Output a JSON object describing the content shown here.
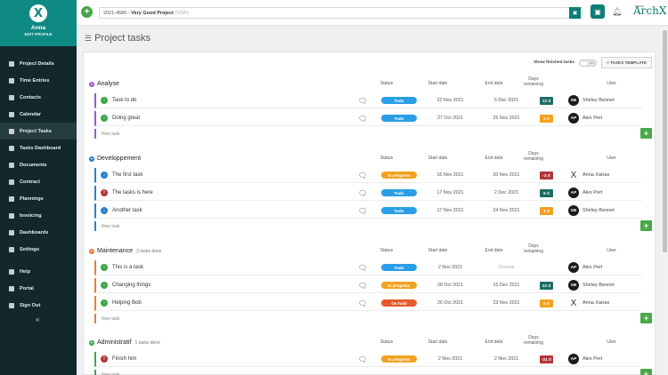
{
  "sidebar": {
    "user_name": "Anna",
    "edit_profile": "EDIT PROFILE",
    "items": [
      {
        "label": "Project Details",
        "icon": "page-icon"
      },
      {
        "label": "Time Entries",
        "icon": "clock-icon"
      },
      {
        "label": "Contacts",
        "icon": "contacts-icon"
      },
      {
        "label": "Calendar",
        "icon": "calendar-icon"
      },
      {
        "label": "Project Tasks",
        "icon": "tasks-icon",
        "active": true
      },
      {
        "label": "Tasks Dashboard",
        "icon": "dashboard-icon"
      },
      {
        "label": "Documents",
        "icon": "folder-icon"
      },
      {
        "label": "Contract",
        "icon": "contract-icon"
      },
      {
        "label": "Plannings",
        "icon": "planning-icon"
      },
      {
        "label": "Invoicing",
        "icon": "invoice-icon"
      },
      {
        "label": "Dashboards",
        "icon": "chart-icon"
      },
      {
        "label": "Settings",
        "icon": "gear-icon"
      }
    ],
    "footer": [
      {
        "label": "Help",
        "icon": "help-icon"
      },
      {
        "label": "Portal",
        "icon": "portal-icon"
      },
      {
        "label": "Sign Out",
        "icon": "signout-icon"
      }
    ],
    "collapse": "«"
  },
  "topbar": {
    "project_code": "2021-4586 - ",
    "project_name": "Very Good Project",
    "project_suffix": " (VGP)",
    "brand_small": "cloud",
    "brand": "ArchX"
  },
  "page": {
    "title": "Project tasks",
    "show_finished_label": "Show finished tasks",
    "toggle_label": "NO",
    "template_button": "+ TASKS TEMPLATE"
  },
  "columns": {
    "status": "Status",
    "start": "Start date",
    "end": "End date",
    "days": "Days remaining",
    "user": "User"
  },
  "new_task_placeholder": "New task",
  "colors": {
    "brand": "#0f8a82",
    "todo": "#2a9ee6",
    "in_progress": "#f0a220",
    "on_hold": "#e55a2a",
    "done_green": "#4aa84a"
  },
  "sections": [
    {
      "title": "Analyse",
      "done": "",
      "color": "#9b59d0",
      "tasks": [
        {
          "name": "Task to do",
          "icon": "up",
          "status": "Todo",
          "status_color": "#2a9ee6",
          "start": "22 Nov 2021",
          "end": "5 Dec 2021",
          "days": "12 d",
          "days_color": "#1e6b63",
          "initials": "SB",
          "user": "Shirley Bennet"
        },
        {
          "name": "Doing great",
          "icon": "up",
          "status": "Todo",
          "status_color": "#2a9ee6",
          "start": "27 Oct 2021",
          "end": "25 Nov 2021",
          "days": "2 d",
          "days_color": "#f0a220",
          "initials": "AP",
          "user": "Alex Pert"
        }
      ]
    },
    {
      "title": "Developpement",
      "done": "",
      "color": "#2a80d0",
      "tasks": [
        {
          "name": "The first task",
          "icon": "down",
          "status": "In progress",
          "status_color": "#f0a220",
          "start": "16 Nov 2021",
          "end": "20 Nov 2021",
          "days": "-3 d",
          "days_color": "#b0353a",
          "initials": "X",
          "user": "Anna Xatrax"
        },
        {
          "name": "The tasks is here",
          "icon": "urgent",
          "status": "Todo",
          "status_color": "#2a9ee6",
          "start": "17 Nov 2021",
          "end": "2 Dec 2021",
          "days": "9 d",
          "days_color": "#1e6b63",
          "initials": "AP",
          "user": "Alex Pert"
        },
        {
          "name": "Another task",
          "icon": "down",
          "status": "Todo",
          "status_color": "#2a9ee6",
          "start": "17 Nov 2021",
          "end": "24 Nov 2021",
          "days": "1 d",
          "days_color": "#f0a220",
          "initials": "SB",
          "user": "Shirley Bennet"
        }
      ]
    },
    {
      "title": "Maintenance",
      "done": "2 tasks done",
      "color": "#ee7b3a",
      "tasks": [
        {
          "name": "This is a task",
          "icon": "up",
          "status": "Todo",
          "status_color": "#2a9ee6",
          "start": "2 Nov 2021",
          "end": "Choose",
          "days": "",
          "days_color": "",
          "initials": "AP",
          "user": "Alex Pert"
        },
        {
          "name": "Changing things",
          "icon": "up",
          "status": "In progress",
          "status_color": "#f0a220",
          "start": "28 Oct 2021",
          "end": "15 Dec 2021",
          "days": "22 d",
          "days_color": "#1e6b63",
          "initials": "SB",
          "user": "Shirley Bennet"
        },
        {
          "name": "Helping Bob",
          "icon": "up",
          "status": "On hold",
          "status_color": "#e55a2a",
          "start": "26 Oct 2021",
          "end": "23 Nov 2021",
          "days": "0 d",
          "days_color": "#f0a220",
          "initials": "X",
          "user": "Anna Xatrax"
        }
      ]
    },
    {
      "title": "Administratif",
      "done": "1 tasks done",
      "color": "#3aa84a",
      "tasks": [
        {
          "name": "Finish him",
          "icon": "urgent",
          "status": "In progress",
          "status_color": "#f0a220",
          "start": "2 Nov 2021",
          "end": "2 Nov 2021",
          "days": "-21 d",
          "days_color": "#b0353a",
          "initials": "AP",
          "user": "Alex Pert"
        }
      ]
    }
  ]
}
